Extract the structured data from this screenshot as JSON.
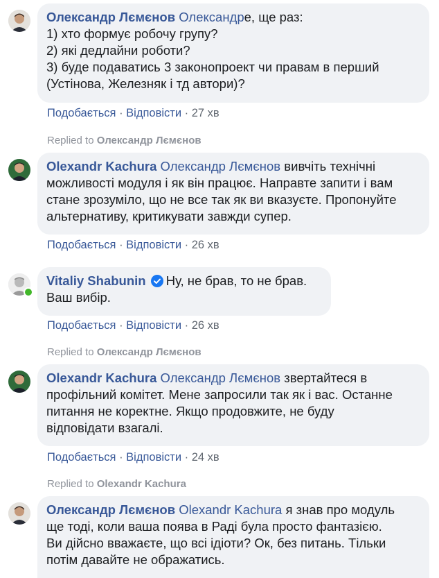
{
  "comments": [
    {
      "author": "Олександр Лємєнов",
      "mention": "Олександр",
      "text": "е, ще раз:",
      "lines": [
        "1) хто формує робочу групу?",
        "2) які дедлайни роботи?",
        "3) буде подаватись 3 законопроект чи правам в перший",
        "(Устінова, Железняк і тд автори)?"
      ],
      "like": "Подобається",
      "reply": "Відповісти",
      "time": "27 хв"
    },
    {
      "replied_prefix": "Replied to",
      "replied_to": "Олександр Лємєнов",
      "author": "Olexandr Kachura",
      "mention": "Олександр Лємєнов",
      "text": " вивчіть технічні",
      "lines": [
        "можливості модуля і як він працює. Направте запити і вам",
        "стане зрозуміло, що не все так як ви вказуєте. Пропонуйте",
        "альтернативу, критикувати завжди супер."
      ],
      "like": "Подобається",
      "reply": "Відповісти",
      "time": "26 хв"
    },
    {
      "author": "Vitaliy Shabunin",
      "text": "Ну, не брав, то не брав.",
      "lines": [
        "Ваш вибір."
      ],
      "like": "Подобається",
      "reply": "Відповісти",
      "time": "26 хв"
    },
    {
      "replied_prefix": "Replied to",
      "replied_to": "Олександр Лємєнов",
      "author": "Olexandr Kachura",
      "mention": "Олександр Лємєнов",
      "text": " звертайтеся в",
      "lines": [
        "профільний комітет. Мене запросили так як і вас. Останне",
        "питання не коректне. Якщо продовжите, не буду",
        "відповідати взагалі."
      ],
      "like": "Подобається",
      "reply": "Відповісти",
      "time": "24 хв"
    },
    {
      "replied_prefix": "Replied to",
      "replied_to": "Olexandr Kachura",
      "author": "Олександр Лємєнов",
      "mention": "Olexandr Kachura",
      "text": " я знав про модуль",
      "lines": [
        "ще тоді, коли ваша поява в Раді була просто фантазією.",
        "Ви дійсно вважаєте, що всі ідіоти? Ок, без питань. Тільки",
        "потім давайте не ображатись."
      ]
    }
  ],
  "separator": "·",
  "icons": {
    "verified": "verified-badge-icon",
    "online": "online-status-icon"
  },
  "colors": {
    "link": "#385898",
    "bubble": "#f0f2f5",
    "meta": "#606770",
    "replied": "#90949c",
    "verified": "#1877f2",
    "online": "#42b72a"
  }
}
